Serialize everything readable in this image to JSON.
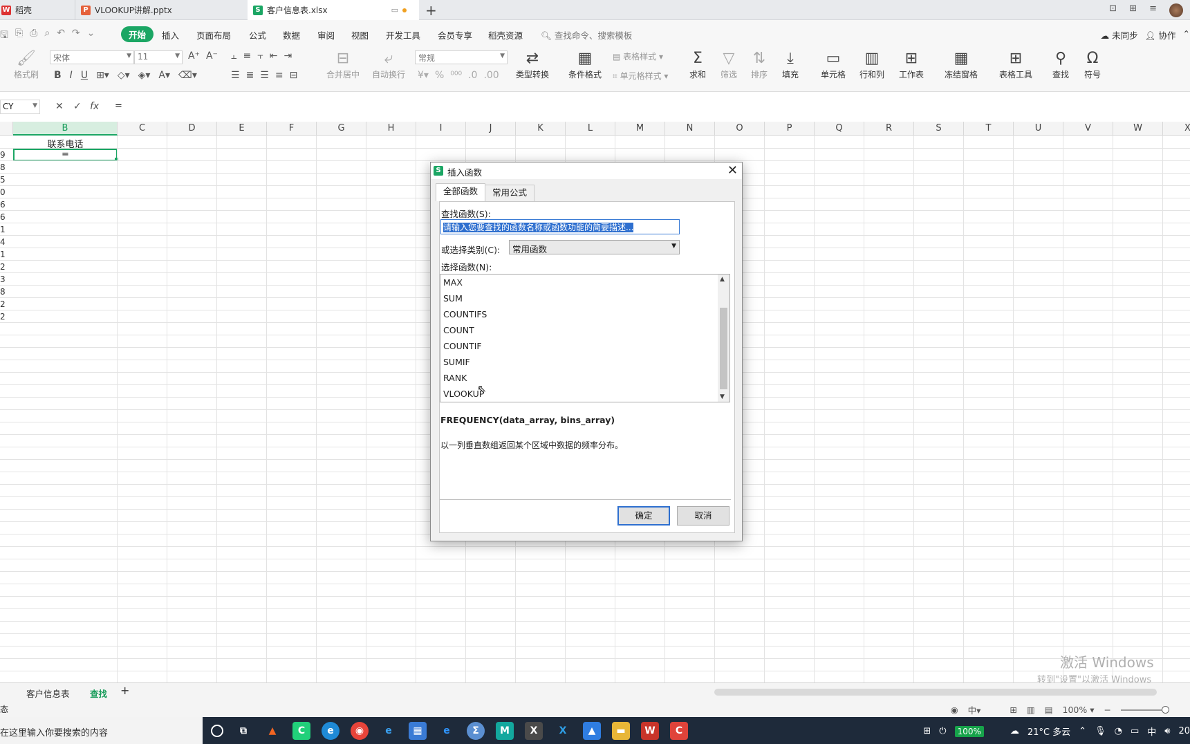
{
  "tabs": [
    {
      "label": "稻壳",
      "icon": "wps-icon",
      "color": "#d33"
    },
    {
      "label": "VLOOKUP讲解.pptx",
      "icon": "ppt-icon",
      "color": "#e5603a"
    },
    {
      "label": "客户信息表.xlsx",
      "icon": "sheet-icon",
      "color": "#1ba664",
      "active": true
    }
  ],
  "menu": {
    "items": [
      "开始",
      "插入",
      "页面布局",
      "公式",
      "数据",
      "审阅",
      "视图",
      "开发工具",
      "会员专享",
      "稻壳资源"
    ],
    "search": "查找命令、搜索模板",
    "unsynced": "未同步",
    "collab": "协作"
  },
  "ribbon": {
    "format_painter": "格式刷",
    "font": "宋体",
    "size": "11",
    "merge": "合并居中",
    "wrap": "自动换行",
    "number_format": "常规",
    "type_convert": "类型转换",
    "cond_format": "条件格式",
    "table_style": "表格样式",
    "cell_style": "单元格样式",
    "sum": "求和",
    "filter": "筛选",
    "sort": "排序",
    "fill": "填充",
    "cell": "单元格",
    "rowcol": "行和列",
    "sheet": "工作表",
    "freeze": "冻结窗格",
    "tools": "表格工具",
    "find": "查找",
    "symbol": "符号"
  },
  "formula": {
    "namebox": "CY",
    "content": "="
  },
  "columns": [
    "B",
    "C",
    "D",
    "E",
    "F",
    "G",
    "H",
    "I",
    "J",
    "K",
    "L",
    "M",
    "N",
    "O",
    "P",
    "Q",
    "R",
    "S",
    "T",
    "U",
    "V",
    "W",
    "X"
  ],
  "rows": [
    "9",
    "8",
    "5",
    "0",
    "6",
    "6",
    "1",
    "4",
    "1",
    "2",
    "3",
    "8",
    "2",
    "2"
  ],
  "cells": {
    "header": "联系电话",
    "active": "="
  },
  "dialog": {
    "title": "插入函数",
    "tab_all": "全部函数",
    "tab_common": "常用公式",
    "search_label": "查找函数(S):",
    "search_placeholder": "请输入您要查找的函数名称或函数功能的简要描述...",
    "category_label": "或选择类别(C):",
    "category_value": "常用函数",
    "list_label": "选择函数(N):",
    "functions": [
      "MAX",
      "SUM",
      "COUNTIFS",
      "COUNT",
      "COUNTIF",
      "SUMIF",
      "RANK",
      "VLOOKUP"
    ],
    "signature": "FREQUENCY(data_array, bins_array)",
    "description": "以一列垂直数组返回某个区域中数据的频率分布。",
    "ok": "确定",
    "cancel": "取消"
  },
  "sheets": [
    "客户信息表",
    "查找"
  ],
  "status": {
    "left": "态",
    "zoom": "100%"
  },
  "watermark": {
    "line1": "激活 Windows",
    "line2": "转到\"设置\"以激活 Windows"
  },
  "taskbar": {
    "search": "在这里输入你要搜索的内容",
    "battery": "100%",
    "weather": "21°C 多云",
    "ime": "中",
    "year_fragment": "20"
  }
}
